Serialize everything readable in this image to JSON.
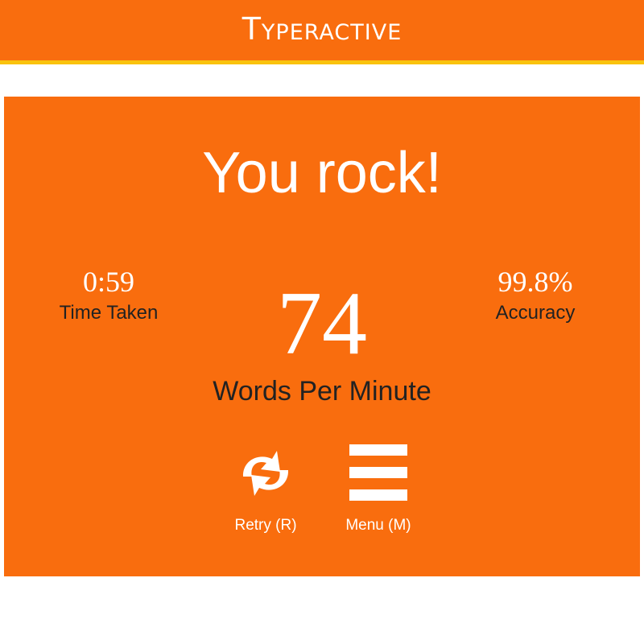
{
  "header": {
    "app_title": "Typeractive",
    "accent_color": "#f96d0e",
    "stripe_color": "#f9c30e"
  },
  "results": {
    "headline": "You rock!",
    "time_taken": {
      "value": "0:59",
      "label": "Time Taken"
    },
    "wpm": {
      "value": "74",
      "label": "Words Per Minute"
    },
    "accuracy": {
      "value": "99.8%",
      "label": "Accuracy"
    }
  },
  "actions": {
    "retry": {
      "label": "Retry (R)",
      "icon": "refresh-icon"
    },
    "menu": {
      "label": "Menu (M)",
      "icon": "hamburger-menu-icon"
    }
  }
}
